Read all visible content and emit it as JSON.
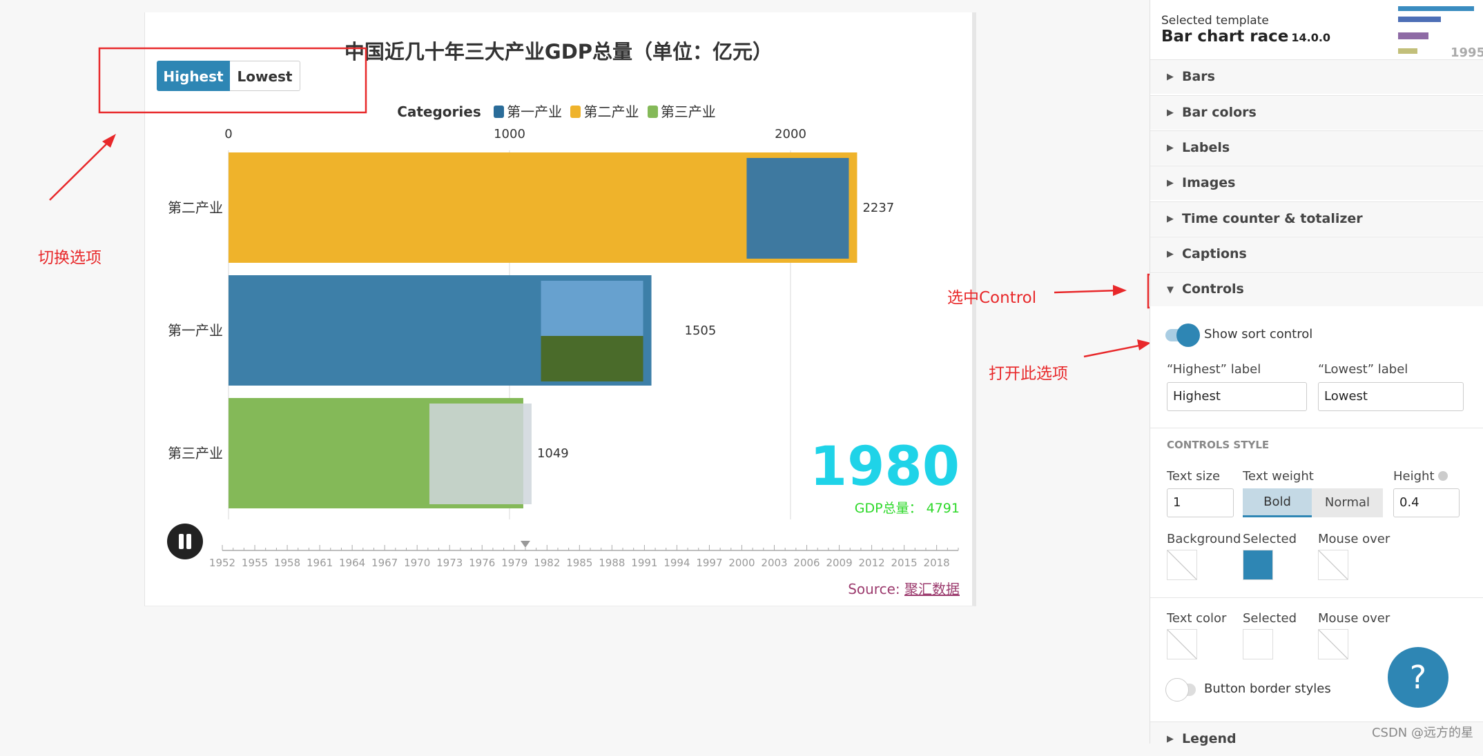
{
  "chart": {
    "title": "中国近几十年三大产业GDP总量（单位：亿元）",
    "sort_buttons": {
      "highest": "Highest",
      "lowest": "Lowest"
    },
    "legend": {
      "title": "Categories",
      "items": [
        {
          "label": "第一产业",
          "color": "#2a6c99"
        },
        {
          "label": "第二产业",
          "color": "#efb32b"
        },
        {
          "label": "第三产业",
          "color": "#84b958"
        }
      ]
    },
    "big_year": "1980",
    "totalizer": "GDP总量：  4791",
    "source_prefix": "Source: ",
    "source_link": "聚汇数据"
  },
  "chart_data": {
    "type": "bar",
    "orientation": "horizontal",
    "x_ticks": [
      "0",
      "1000",
      "2000"
    ],
    "xlim": [
      0,
      2600
    ],
    "grid": true,
    "categories": [
      "第二产业",
      "第一产业",
      "第三产业"
    ],
    "values": [
      2237,
      1505,
      1049
    ],
    "value_labels": [
      "2237",
      "1505",
      "1049"
    ],
    "colors": [
      "#efb32b",
      "#3d7fa8",
      "#84b958"
    ],
    "timeline": [
      "1952",
      "1955",
      "1958",
      "1961",
      "1964",
      "1967",
      "1970",
      "1973",
      "1976",
      "1979",
      "1982",
      "1985",
      "1988",
      "1991",
      "1994",
      "1997",
      "2000",
      "2003",
      "2006",
      "2009",
      "2012",
      "2015",
      "2018"
    ],
    "timeline_current": 1980
  },
  "annotations": {
    "switch": "切换选项",
    "select_control": "选中Control",
    "open_option": "打开此选项"
  },
  "panel": {
    "selected_template_label": "Selected template",
    "template_name": "Bar chart race",
    "template_version": "14.0.0",
    "thumb_year": "1995",
    "sections": [
      "Bars",
      "Bar colors",
      "Labels",
      "Images",
      "Time counter & totalizer",
      "Captions",
      "Controls"
    ],
    "show_sort_control": "Show sort control",
    "highest_label_caption": "“Highest” label",
    "lowest_label_caption": "“Lowest” label",
    "highest_value": "Highest",
    "lowest_value": "Lowest",
    "controls_style_heading": "CONTROLS STYLE",
    "text_size_label": "Text size",
    "text_size_value": "1",
    "text_weight_label": "Text weight",
    "weight_bold": "Bold",
    "weight_normal": "Normal",
    "height_label": "Height",
    "height_value": "0.4",
    "background_label": "Background",
    "selected_label": "Selected",
    "mouse_over_label": "Mouse over",
    "text_color_label": "Text color",
    "border_styles_label": "Button border styles",
    "legend_section": "Legend",
    "selected_color": "#2e86b4"
  },
  "help_symbol": "?",
  "watermark": "CSDN @远方的星"
}
